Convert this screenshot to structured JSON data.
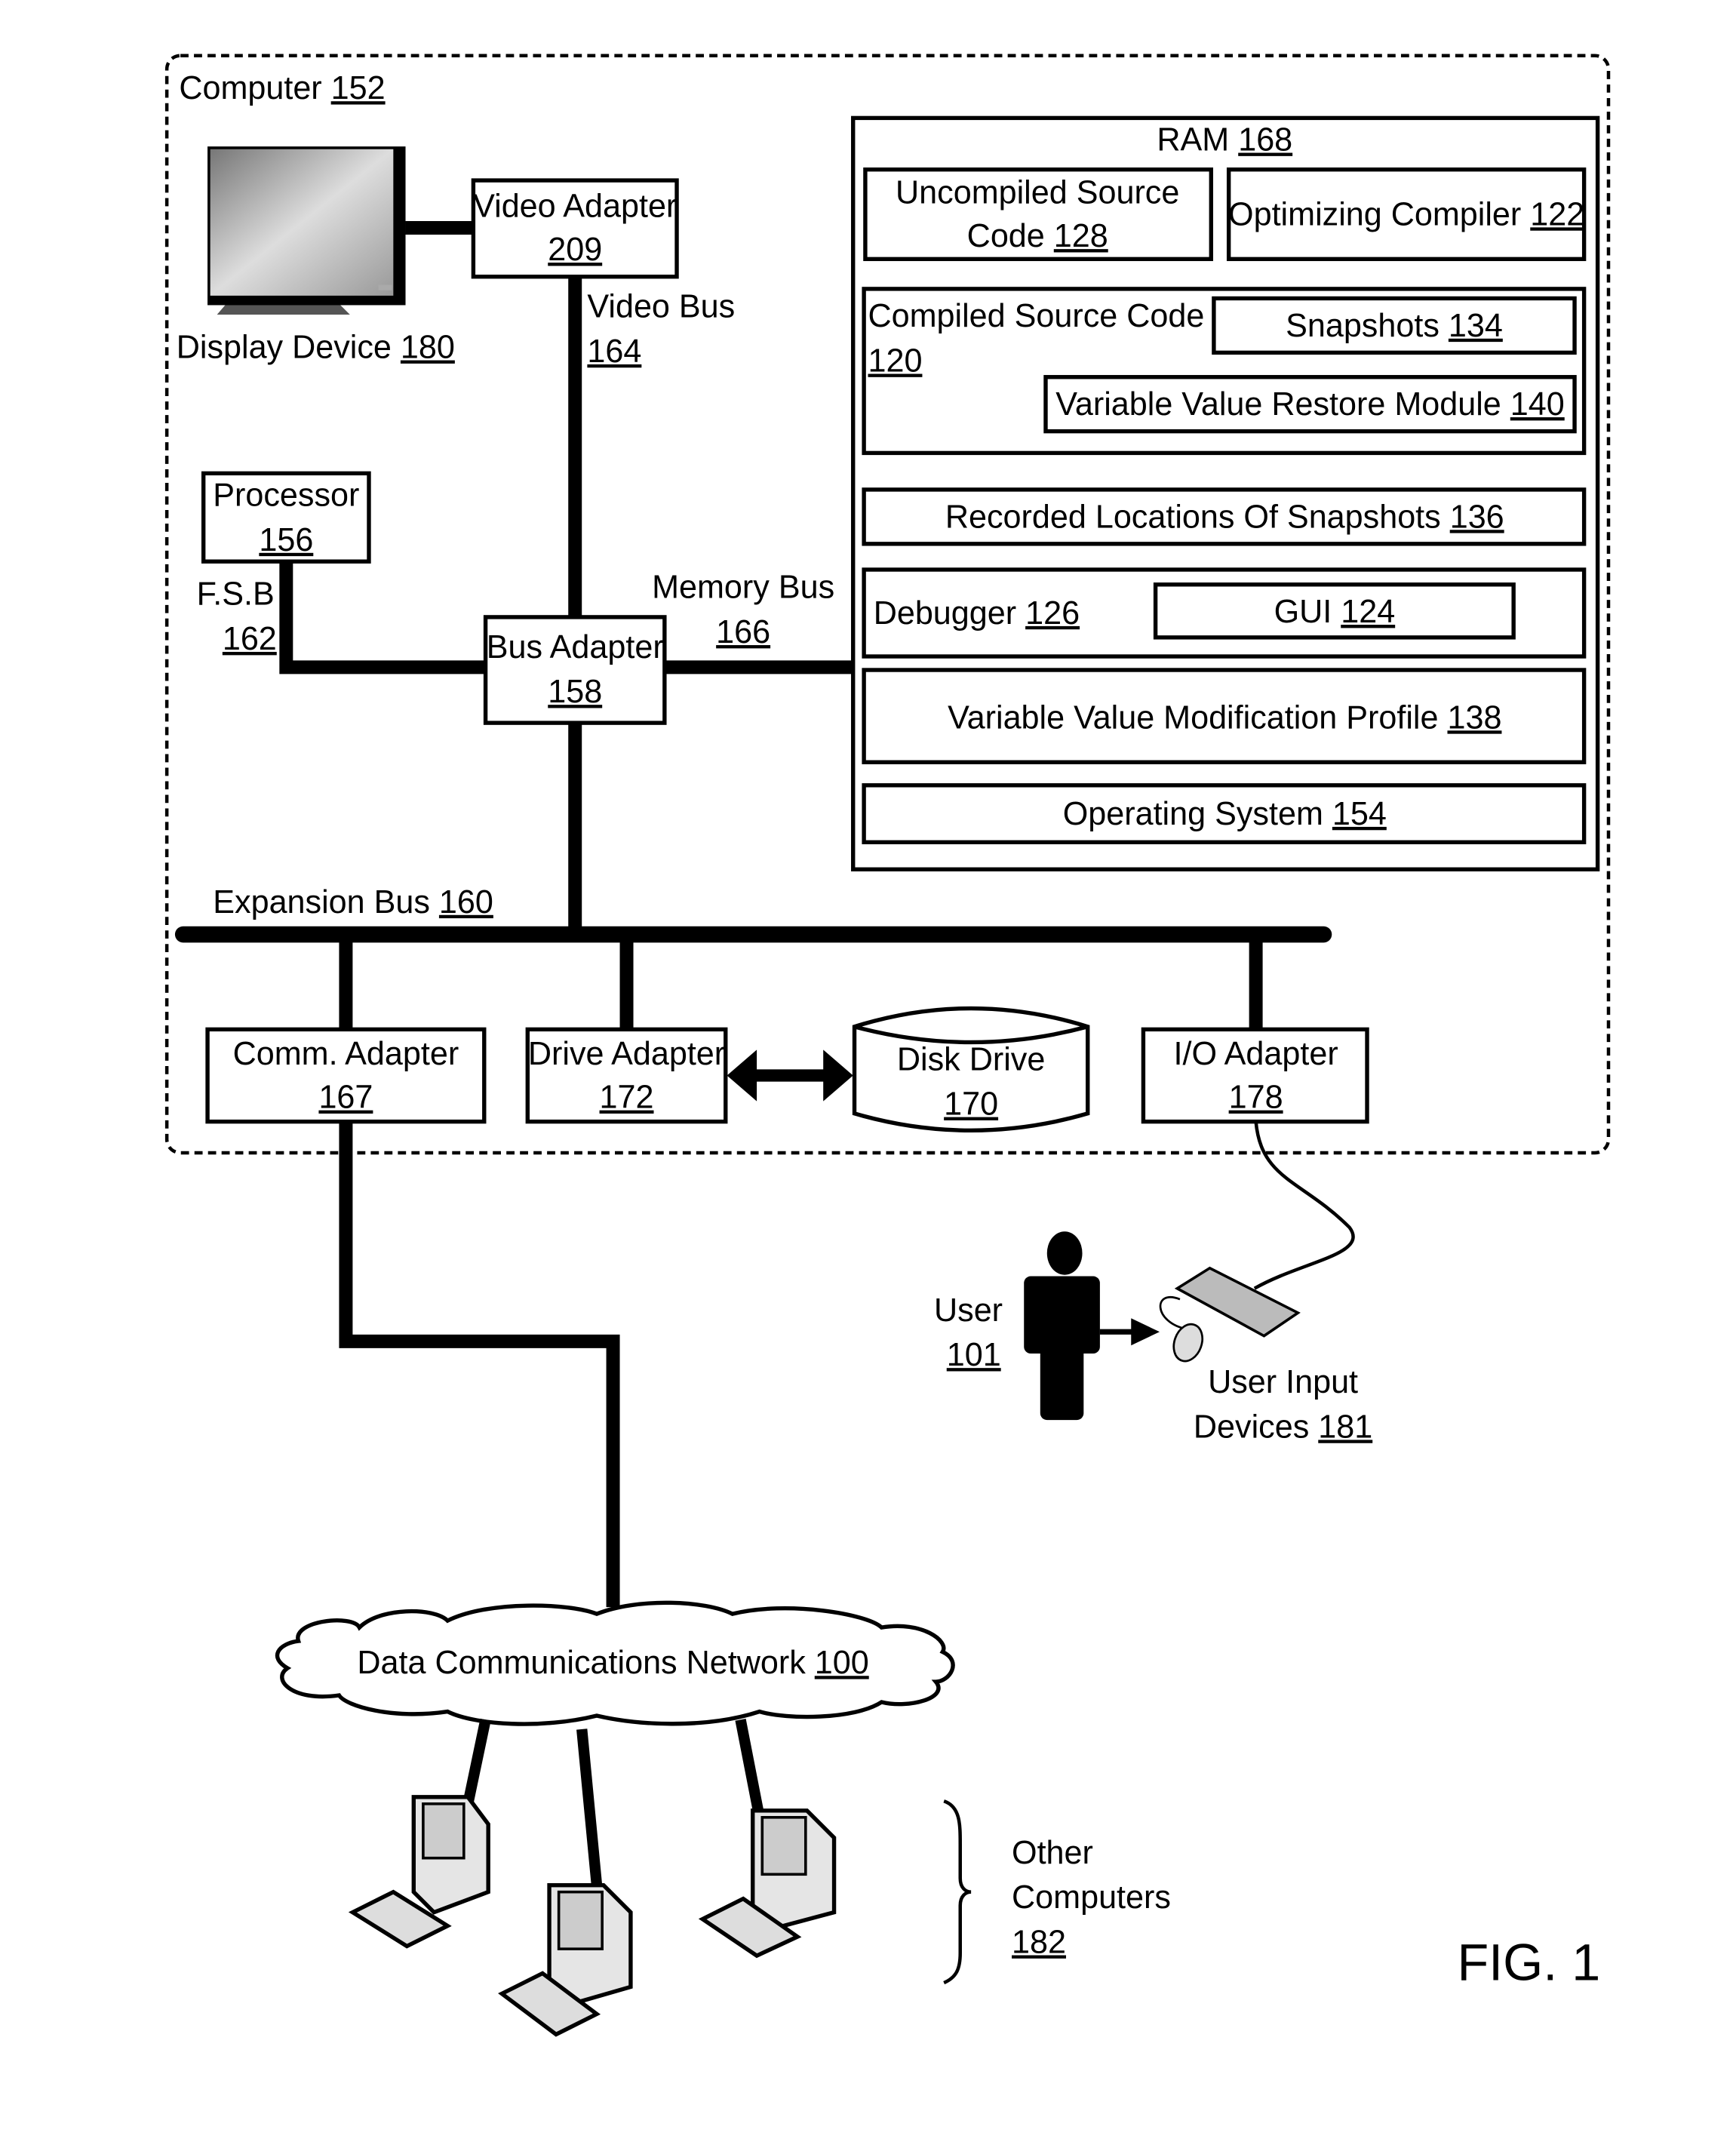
{
  "figure": {
    "label": "FIG. 1",
    "colors": {
      "ink": "#000000",
      "background": "#ffffff"
    }
  },
  "computer": {
    "name": "Computer",
    "ref": "152",
    "display_device": {
      "name": "Display Device",
      "ref": "180"
    },
    "video_adapter": {
      "line1": "Video Adapter",
      "ref": "209"
    },
    "video_bus": {
      "name": "Video Bus",
      "ref": "164"
    },
    "processor": {
      "name": "Processor",
      "ref": "156"
    },
    "fsb": {
      "name": "F.S.B",
      "ref": "162"
    },
    "bus_adapter": {
      "name": "Bus Adapter",
      "ref": "158"
    },
    "memory_bus": {
      "name": "Memory Bus",
      "ref": "166"
    },
    "expansion_bus": {
      "name": "Expansion Bus",
      "ref": "160"
    },
    "comm_adapter": {
      "name": "Comm. Adapter",
      "ref": "167"
    },
    "drive_adapter": {
      "name": "Drive Adapter",
      "ref": "172"
    },
    "disk_drive": {
      "name": "Disk Drive",
      "ref": "170"
    },
    "io_adapter": {
      "name": "I/O Adapter",
      "ref": "178"
    },
    "ram": {
      "name": "RAM",
      "ref": "168",
      "uncompiled_source": {
        "line1": "Uncompiled Source",
        "line2": "Code",
        "ref": "128"
      },
      "optimizing_compiler": {
        "name": "Optimizing Compiler",
        "ref": "122"
      },
      "compiled_source": {
        "name": "Compiled Source Code",
        "ref": "120"
      },
      "snapshots": {
        "name": "Snapshots",
        "ref": "134"
      },
      "restore_module": {
        "name": "Variable Value Restore Module",
        "ref": "140"
      },
      "recorded_locations": {
        "name": "Recorded Locations Of Snapshots",
        "ref": "136"
      },
      "debugger": {
        "name": "Debugger",
        "ref": "126"
      },
      "gui": {
        "name": "GUI",
        "ref": "124"
      },
      "modification_profile": {
        "name": "Variable Value Modification Profile",
        "ref": "138"
      },
      "operating_system": {
        "name": "Operating System",
        "ref": "154"
      }
    }
  },
  "user": {
    "name": "User",
    "ref": "101"
  },
  "user_input_devices": {
    "line1": "User Input",
    "line2": "Devices",
    "ref": "181"
  },
  "network": {
    "name": "Data Communications Network",
    "ref": "100"
  },
  "other_computers": {
    "line1": "Other",
    "line2": "Computers",
    "ref": "182"
  }
}
